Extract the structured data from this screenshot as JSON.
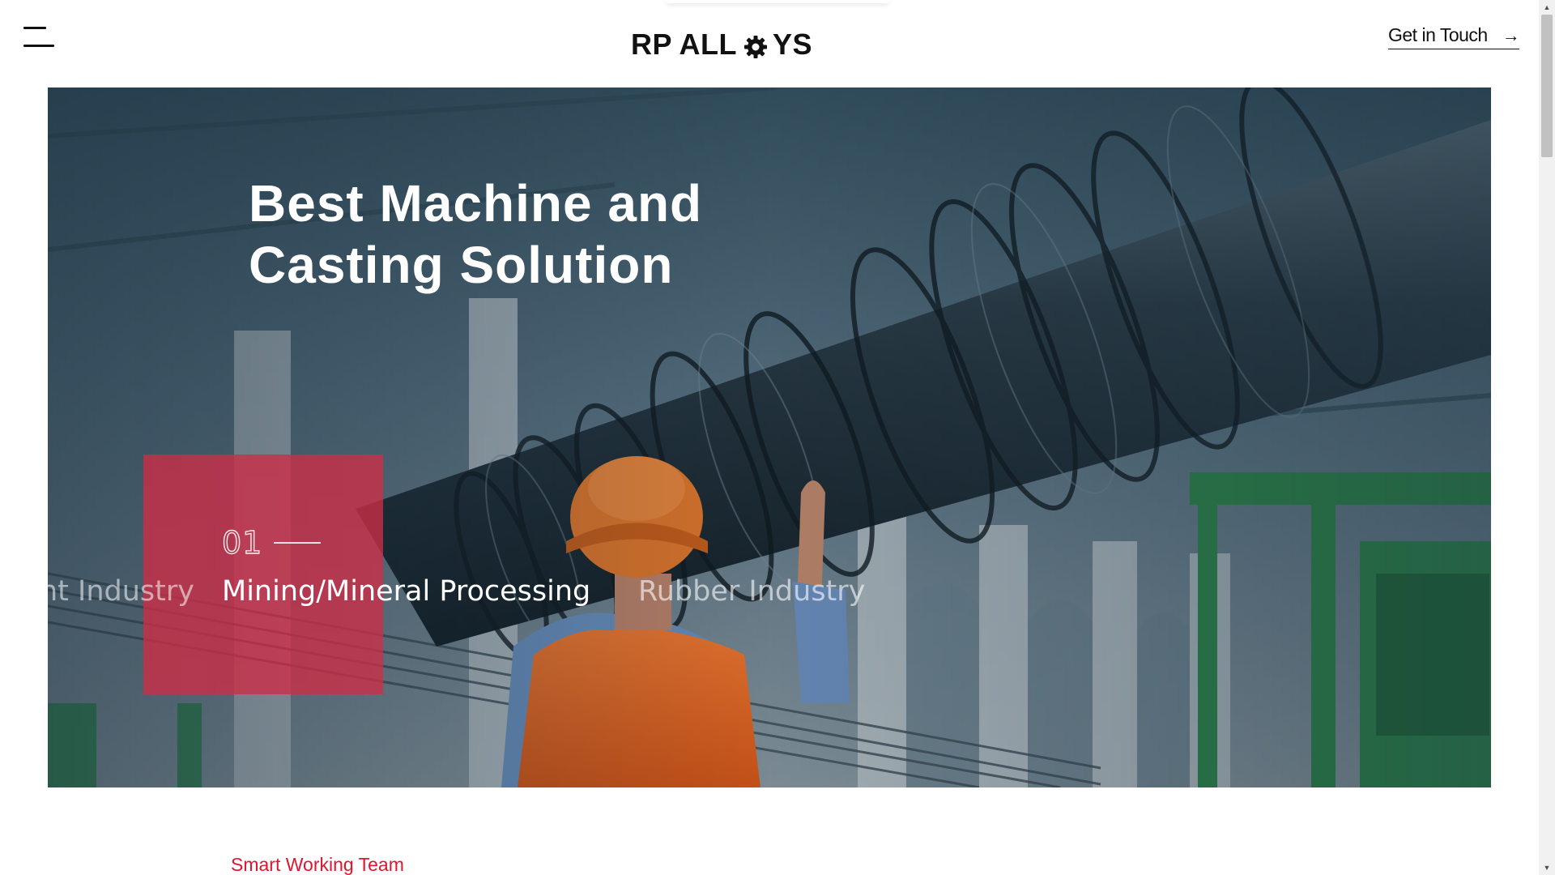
{
  "header": {
    "logo_left": "RP ALL",
    "logo_right": "YS",
    "logo_gear_icon": "gear-icon",
    "menu_icon": "hamburger-menu-icon",
    "cta_label": "Get in Touch",
    "cta_arrow": "→"
  },
  "hero": {
    "title": "Best Machine and\nCasting Solution",
    "slider": {
      "current_number": "01",
      "previous_label": "nt Industry",
      "current_label": "Mining/Mineral Processing",
      "next_label": "Rubber Industry"
    }
  },
  "section": {
    "label": "Smart Working Team"
  },
  "colors": {
    "accent_red": "#e0162e",
    "slider_box": "#ce2d46",
    "hero_tint": "#2c4456"
  },
  "scrollbar": {
    "up_arrow": "▲",
    "down_arrow": "▼"
  }
}
